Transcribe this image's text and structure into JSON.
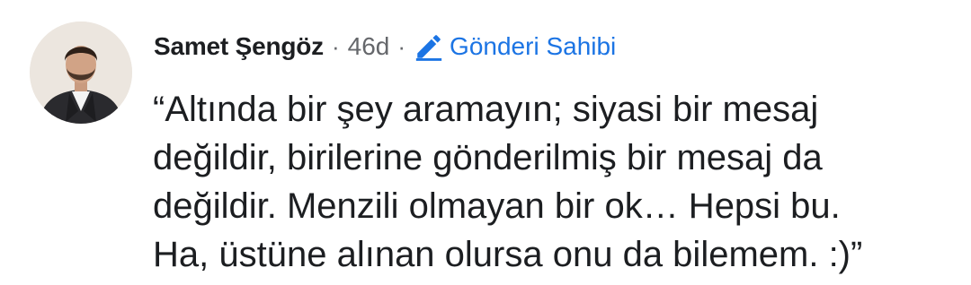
{
  "comment": {
    "author": "Samet Şengöz",
    "separator": "·",
    "time": "46d",
    "badge_label": "Gönderi Sahibi",
    "badge_icon": "pencil-icon",
    "accent_color": "#1b74e4",
    "text_lines": [
      "“Altında bir şey aramayın; siyasi bir mesaj",
      "değildir, birilerine gönderilmiş bir mesaj da",
      "değildir. Menzili olmayan bir ok… Hepsi bu.",
      "Ha, üstüne alınan olursa onu da bilemem. :)”"
    ]
  }
}
